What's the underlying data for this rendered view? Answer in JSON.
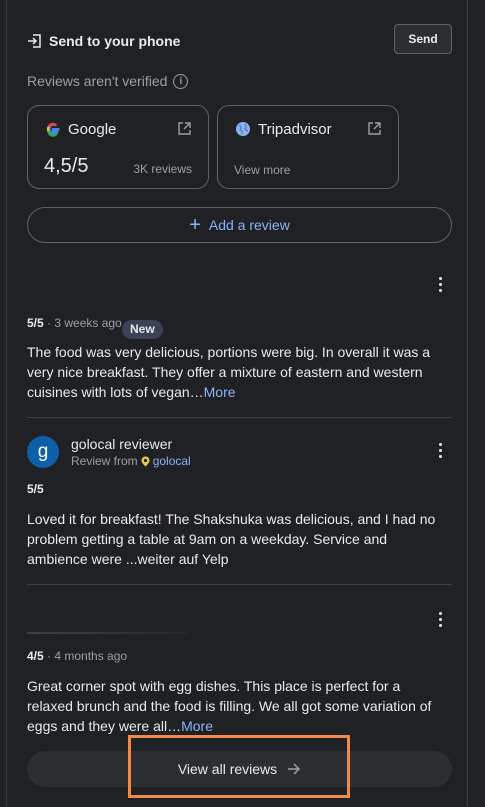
{
  "send": {
    "label": "Send to your phone",
    "button": "Send"
  },
  "verified_note": "Reviews aren't verified",
  "sources": [
    {
      "name": "Google",
      "rating": "4,5/5",
      "count": "3K reviews"
    },
    {
      "name": "Tripadvisor",
      "link": "View more"
    }
  ],
  "add_review": "Add a review",
  "reviews": [
    {
      "score": "5/5",
      "age": " · 3 weeks ago",
      "badge": "New",
      "text": "The food was very delicious, portions were big. In overall it was a very nice breakfast. They offer a mixture of eastern and western cuisines with lots of vegan…",
      "more": "More"
    },
    {
      "avatar_letter": "g",
      "author": "golocal reviewer",
      "source_prefix": "Review from",
      "source_name": "golocal",
      "score": "5/5",
      "text": "Loved it for breakfast! The Shakshuka was delicious, and I had no problem getting a table at 9am on a weekday. Service and ambience were ...weiter auf Yelp"
    },
    {
      "score": "4/5",
      "age": " · 4 months ago",
      "text": "Great corner spot with egg dishes. This place is perfect for a relaxed brunch and the food is filling. We all got some variation of eggs and they were all…",
      "more": "More"
    }
  ],
  "view_all": "View all reviews",
  "colors": {
    "background": "#202124",
    "link": "#8ab4f8",
    "highlight": "#f08a4b"
  }
}
